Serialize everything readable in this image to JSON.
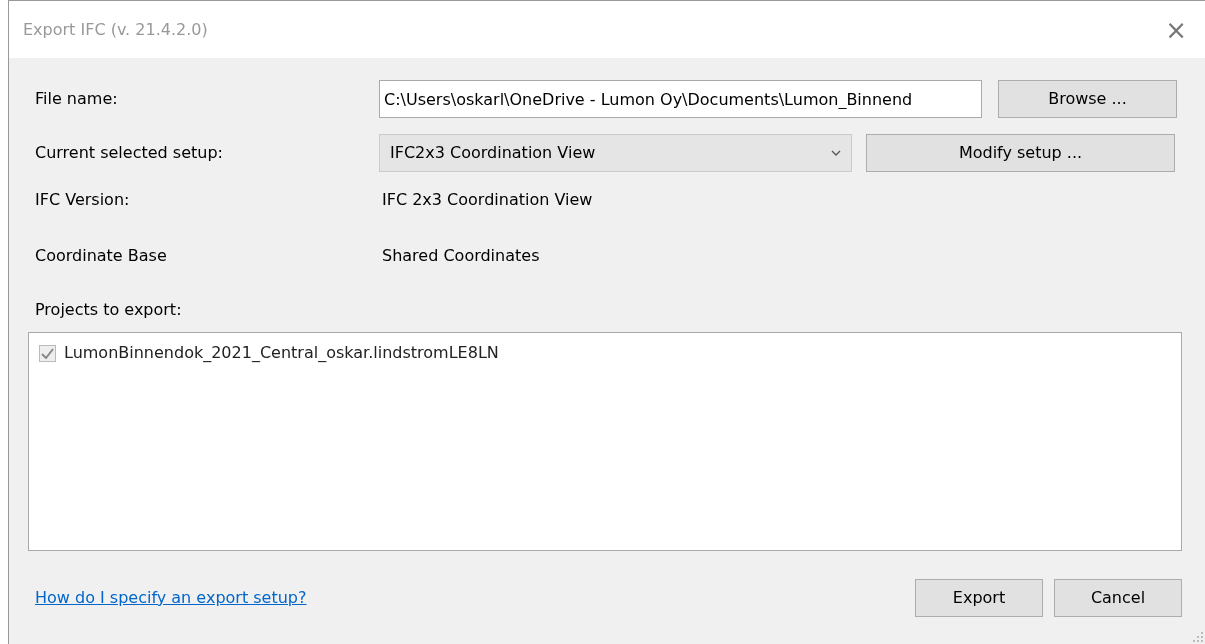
{
  "window": {
    "title": "Export IFC (v. 21.4.2.0)",
    "close": "×"
  },
  "file_name": {
    "label": "File name:",
    "value": "C:\\Users\\oskarl\\OneDrive - Lumon Oy\\Documents\\Lumon_Binnend",
    "button": "Browse ..."
  },
  "setup": {
    "label": "Current selected setup:",
    "value": "IFC2x3 Coordination View",
    "button": "Modify setup ..."
  },
  "info": [
    {
      "label": "IFC Version:",
      "value": "IFC 2x3 Coordination View"
    },
    {
      "label": "Coordinate Base",
      "value": "Shared Coordinates"
    }
  ],
  "projects": {
    "label": "Projects to export:",
    "items": [
      {
        "name": "LumonBinnendok_2021_Central_oskar.lindstromLE8LN",
        "checked": true,
        "disabled": true
      }
    ]
  },
  "help_link": "How do I specify an export setup?",
  "buttons": [
    "Export",
    "Cancel"
  ]
}
